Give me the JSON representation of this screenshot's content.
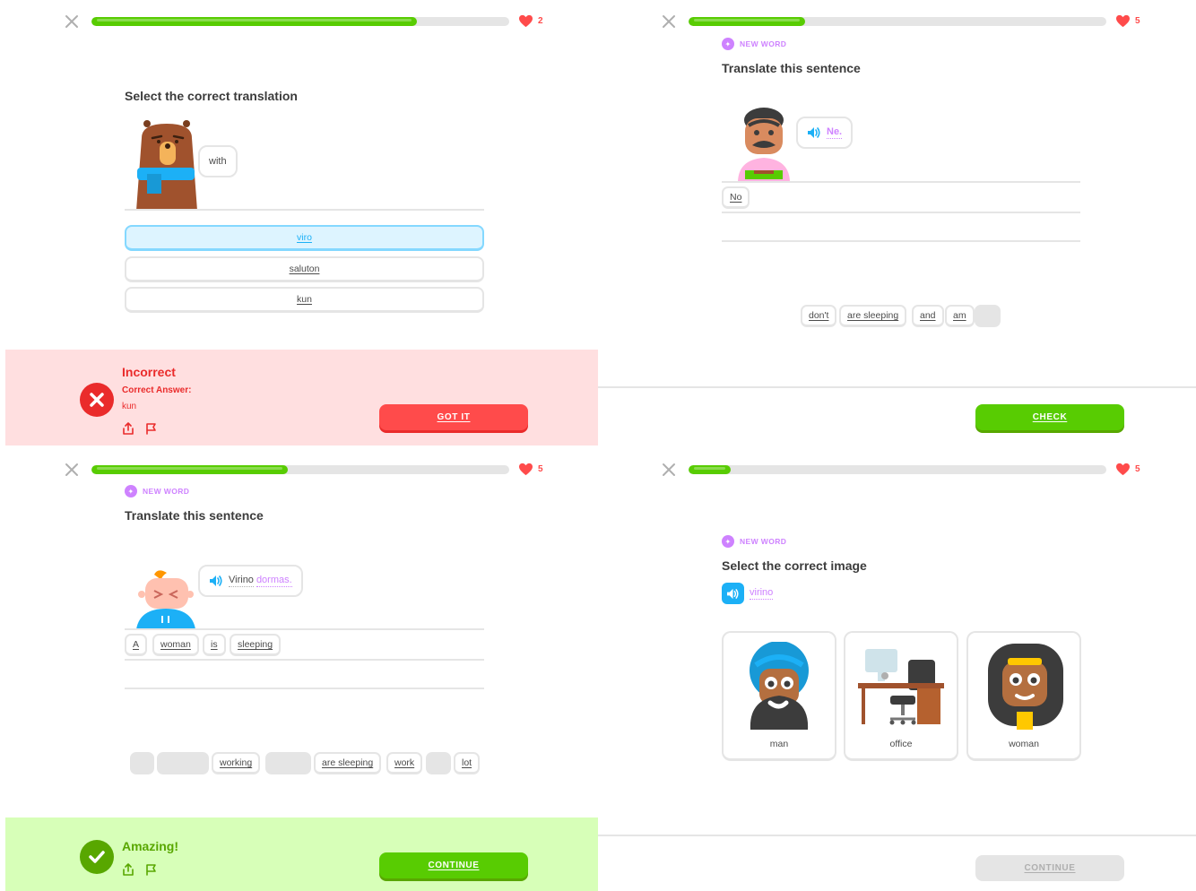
{
  "colors": {
    "green": "#58cc02",
    "red": "#ff4b4b",
    "blue": "#1cb0f6",
    "purple": "#ce82ff",
    "gray": "#e5e5e5"
  },
  "panel1": {
    "progress": 0.78,
    "hearts": "2",
    "title": "Select the correct translation",
    "bubble": "with",
    "options": [
      "viro",
      "saluton",
      "kun"
    ],
    "selected_index": 0,
    "feedback": {
      "status": "Incorrect",
      "correct_label": "Correct Answer:",
      "correct_value": "kun",
      "button": "GOT IT",
      "icons": [
        "share-icon",
        "flag-icon"
      ]
    }
  },
  "panel2": {
    "progress": 0.28,
    "hearts": "5",
    "badge": "NEW WORD",
    "title": "Translate this sentence",
    "bubble": "Ne.",
    "answer_chips": [
      "No"
    ],
    "word_bank": [
      "don't",
      "are sleeping",
      "and",
      "am"
    ],
    "button": "CHECK"
  },
  "panel3": {
    "progress": 0.47,
    "hearts": "5",
    "badge": "NEW WORD",
    "title": "Translate this sentence",
    "bubble_words": [
      "Virino",
      "dormas."
    ],
    "answer_chips": [
      "A",
      "woman",
      "is",
      "sleeping"
    ],
    "word_bank": [
      "working",
      "are sleeping",
      "work",
      "lot"
    ],
    "feedback": {
      "status": "Amazing!",
      "button": "CONTINUE",
      "icons": [
        "share-icon",
        "flag-icon"
      ]
    }
  },
  "panel4": {
    "progress": 0.1,
    "hearts": "5",
    "badge": "NEW WORD",
    "title": "Select the correct image",
    "audio_word": "virino",
    "images": [
      "man",
      "office",
      "woman"
    ],
    "button": "CONTINUE"
  }
}
